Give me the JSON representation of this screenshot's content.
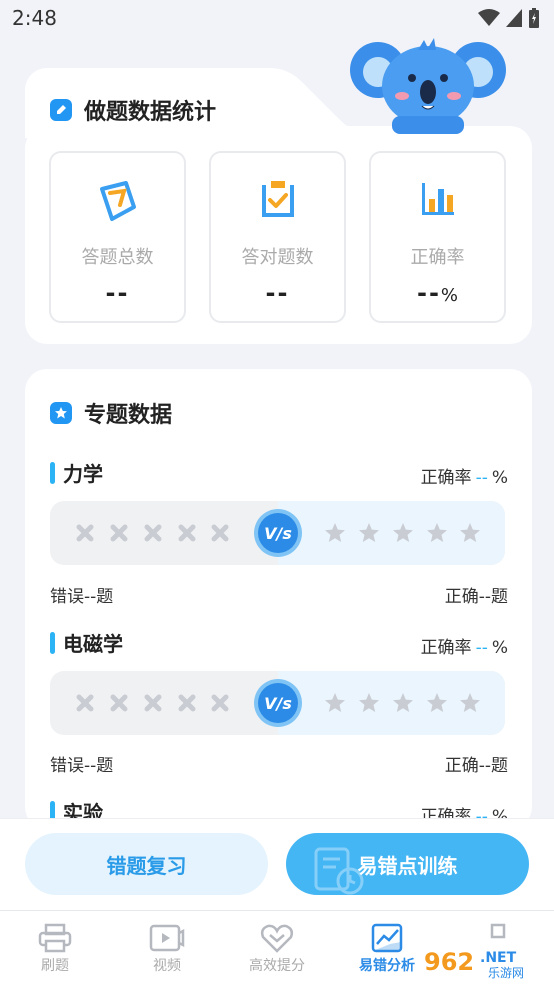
{
  "status_bar": {
    "time": "2:48"
  },
  "stats": {
    "title": "做题数据统计",
    "items": [
      {
        "label": "答题总数",
        "value": "--",
        "unit": ""
      },
      {
        "label": "答对题数",
        "value": "--",
        "unit": ""
      },
      {
        "label": "正确率",
        "value": "--",
        "unit": "%"
      }
    ]
  },
  "topics": {
    "title": "专题数据",
    "rate_label": "正确率",
    "rate_value": "--",
    "rate_unit": "%",
    "vs_label": "V/s",
    "items": [
      {
        "name": "力学",
        "wrong": "错误--题",
        "right": "正确--题"
      },
      {
        "name": "电磁学",
        "wrong": "错误--题",
        "right": "正确--题"
      },
      {
        "name": "实验"
      }
    ]
  },
  "actions": {
    "review": "错题复习",
    "train": "易错点训练"
  },
  "tabs": [
    {
      "label": "刷题",
      "icon": "printer-icon"
    },
    {
      "label": "视频",
      "icon": "video-icon"
    },
    {
      "label": "高效提分",
      "icon": "heart-chevron-icon"
    },
    {
      "label": "易错分析",
      "icon": "chart-icon",
      "active": true
    },
    {
      "label": "",
      "icon": "profile-icon"
    }
  ],
  "watermark": {
    "text": "962",
    "suffix": ".NET",
    "sub": "乐游网"
  },
  "colors": {
    "accent": "#2b8be6",
    "accent_light": "#45b6f4",
    "background": "#f1f3f8"
  }
}
